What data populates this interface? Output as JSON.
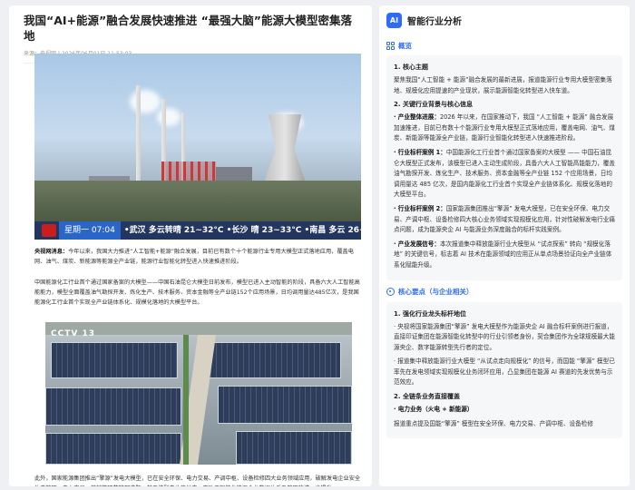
{
  "article": {
    "title": "我国“AI+能源”融合发展快速推进 “最强大脑”能源大模型密集落地",
    "meta": "来源：央视网 | 2026年06月01日 11:53:03",
    "ticker": {
      "time_label": "星期一  07:04",
      "weather": "•武汉 多云转晴 21~32°C  •长沙 晴 23~33°C  •南昌 多云 26~3"
    },
    "image2_badge": "CCTV 13",
    "paragraphs": [
      {
        "lead": "央视网消息：",
        "text": "今年以来，我国大力推进“人工智能+能源”融合发展，目前已有数个十个能源行业专用大模型正式落地应用，覆盖电网、油气、煤炭、新能源等能源全产业链，能源行业智能化转型进入快速推进阶段。"
      },
      {
        "lead": "",
        "text": "中国能源化工行业首个通过国家备案的大模型——中国石油昆仑大模型日前发布，模型已进入主动智能的阶段，具备六大人工智能高能能力，模型全面覆盖油气勘探开发、炼化生产、技术服务、资本金融等全产业链152个应用场景，日均调用量达485亿次，是我国能源化工行业首个实现全产业链体系化、规模化落地的大模型平台。"
      },
      {
        "lead": "",
        "text": "此外，国家能源集团推出“擎源”发电大模型，已在安全环保、电力交易、产调中枢、设备检修四大业务领域应用，破解发电企业安全生产管理、电力交易、营销等环节管理难题，基于模型产业落地中，有助于智能化能源企业数据体系及管理的进一步提升。"
      }
    ]
  },
  "panel": {
    "title": "智能行业分析",
    "overview": {
      "title": "概览",
      "h1": "1. 核心主题",
      "p1": "聚焦我国“人工智能 + 能源”融合发展的最新进展，报道能源行业专用大模型密集落地、规模化应用提速的产业现状，展示能源智能化转型进入快车道。",
      "h2": "2. 关键行业背景与核心信息",
      "items": [
        {
          "lead": "· 产业整体进展：",
          "text": "2026 年以来，在国家推动下，我国 “人工智能 + 能源” 融合发展加速推进，目前已有数十个能源行业专用大模型正式落地应用，覆盖电网、油气、煤炭、新能源等能源全产业链，能源行业智能化转型进入快速推进阶段。"
        },
        {
          "lead": "· 行业标杆案例 1：",
          "text": "中国能源化工行业首个通过国家备案的大模型 —— 中国石油昆仑大模型正式发布，该模型已进入主动生成阶段，具备六大人工智能高能能力，覆盖油气勘探开发、炼化生产、技术服务、资本金融等全产业链 152 个应用场景，日均调用量达 485 亿次，是国内能源化工行业首个实现全产业链体系化、规模化落地的大模型平台。"
        },
        {
          "lead": "· 行业标杆案例 2：",
          "text": "国家能源集团推出“擎源” 发电大模型，已在安全环保、电力交易、产调中枢、设备检修四大核心业务领域实现规模化应用，针对性破解发电行业痛点问题，成为能源央企 AI 与能源业务深度融合的标杆实践案例。"
        },
        {
          "lead": "· 产业发展信号：",
          "text": "本次报道集中释放能源行业大模型从 “试点探索” 转向 “规模化落地” 的关键信号，标志着 AI 技术在能源领域的应用正从单点场景验证向全产业链体系化赋能升级。"
        }
      ]
    },
    "key": {
      "title": "核心要点（与企业相关）",
      "h1": "1. 强化行业龙头标杆地位",
      "items": [
        "· 央视将国家能源集团“擎源” 发电大模型作为能源央企 AI 融合标杆案例进行报道，直接印证集团在能源智能化转型中的行业引领者身份，契合集团作为全球规模最大能源央企、数字能源转型先行者的定位。",
        "· 报道集中释放能源行业大模型 “从试点走向规模化” 的信号，而国能 “擎源” 模型已率先在发电领域实现规模化业务闭环应用，凸显集团在能源 AI 赛道的先发优势与示范效应。"
      ],
      "h2": "2. 全链条业务直接覆盖",
      "sub": "· 电力业务（火电 + 新能源）",
      "sub_text": "报道重点提及国能“擎源” 模型在安全环保、电力交易、产调中枢、设备检修"
    }
  }
}
